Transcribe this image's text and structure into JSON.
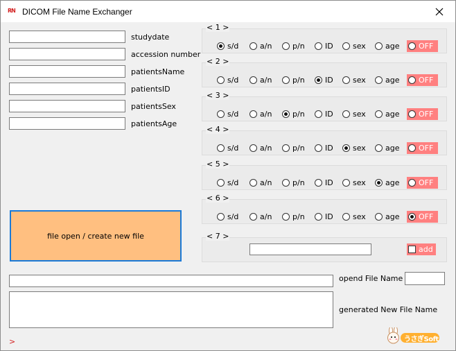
{
  "window": {
    "title": "DICOM File Name Exchanger",
    "icon": "app-icon"
  },
  "fields": [
    {
      "label": "studydate",
      "value": ""
    },
    {
      "label": "accession number",
      "value": ""
    },
    {
      "label": "patientsName",
      "value": ""
    },
    {
      "label": "patientsID",
      "value": ""
    },
    {
      "label": "patientsSex",
      "value": ""
    },
    {
      "label": "patientsAge",
      "value": ""
    }
  ],
  "radio_labels": [
    "s/d",
    "a/n",
    "p/n",
    "ID",
    "sex",
    "age"
  ],
  "off_label": "OFF",
  "groups": [
    {
      "title": "< 1 >",
      "selected": "s/d"
    },
    {
      "title": "< 2 >",
      "selected": "ID"
    },
    {
      "title": "< 3 >",
      "selected": "p/n"
    },
    {
      "title": "< 4 >",
      "selected": "sex"
    },
    {
      "title": "< 5 >",
      "selected": "age"
    },
    {
      "title": "< 6 >",
      "selected": "OFF"
    }
  ],
  "group7": {
    "title": "< 7 >",
    "value": "",
    "add_label": "add",
    "add_checked": false
  },
  "open_button": "file open / create new file",
  "opened_file": {
    "label": "opend File Name",
    "value": "",
    "count": ""
  },
  "generated": {
    "label": "generated New File Name",
    "value": ""
  },
  "footer": {
    "arrow": ">",
    "logo_text": "うさぎSoft"
  },
  "colors": {
    "off_bg": "#ff8080",
    "open_btn_bg": "#ffbf80",
    "open_btn_border": "#1a7ad8"
  }
}
